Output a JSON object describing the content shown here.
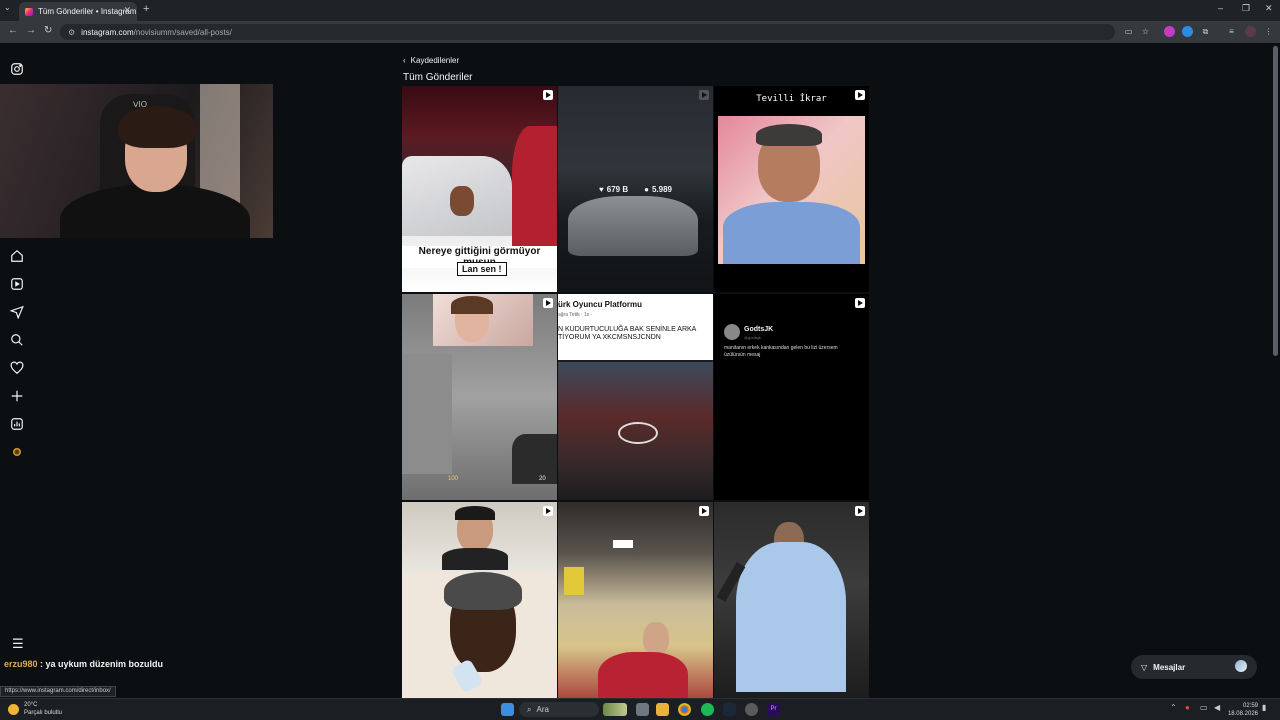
{
  "browser": {
    "tab_title": "Tüm Gönderiler • Instagram",
    "tab_close": "✕",
    "new_tab": "+",
    "url_host": "instagram.com",
    "url_path": "/novisiumm/saved/all-posts/"
  },
  "webcam": {
    "chair_text": "ᐯIO"
  },
  "breadcrumb": {
    "back_label": "Kaydedilenler"
  },
  "page": {
    "title": "Tüm Gönderiler"
  },
  "posts": [
    {
      "caption_line1": "Nereye gittiğini görmüyor musun",
      "caption_line2": "Lan sen !"
    },
    {
      "likes": "679 B",
      "comments": "5.989"
    },
    {
      "header": "Tevilli İkrar"
    },
    {},
    {
      "header": "ürk Oyuncu Platformu",
      "sub": "ağra Tetik · 1s ·",
      "text1": "N KUDURTUCULUĞA BAK SENİNLE ARKA",
      "text2": "TİYORUM YA XKCMSNSJCNDN"
    },
    {
      "author": "GodtsJK",
      "handle": "@godtsjk",
      "text": "manitanın erkek kankasından gelen bu lizi üzersem üzülürsün mesaj"
    },
    {},
    {},
    {}
  ],
  "game_hud": {
    "left": "100",
    "right": "20"
  },
  "chat": {
    "user": "erzu980",
    "message": " : ya uykum düzenim bozuldu"
  },
  "status_url": "https://www.instagram.com/direct/inbox/",
  "messages": {
    "label": "Mesajlar"
  },
  "taskbar": {
    "weather_temp": "20°C",
    "weather_desc": "Parçalı bulutlu",
    "search_label": "Ara",
    "time": "02:59",
    "date": "18.08.2026"
  }
}
